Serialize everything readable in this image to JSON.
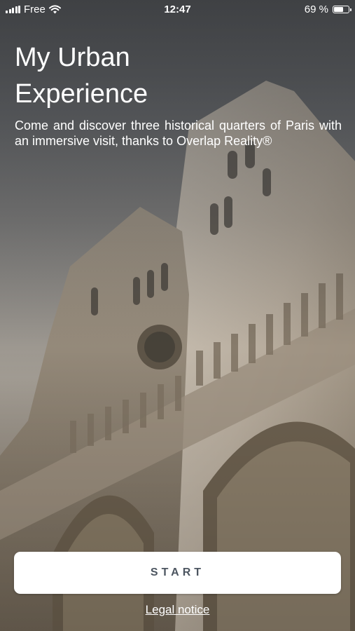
{
  "status_bar": {
    "carrier": "Free",
    "time": "12:47",
    "battery_percent": "69 %",
    "battery_level": 0.69
  },
  "main": {
    "title_line1": "My Urban",
    "title_line2": "Experience",
    "description": "Come and discover three historical quarters of Paris with an immersive visit, thanks to Overlap Reality®"
  },
  "actions": {
    "start_label": "START",
    "legal_label": "Legal notice"
  },
  "icons": [
    "signal-icon",
    "wifi-icon",
    "battery-icon"
  ]
}
